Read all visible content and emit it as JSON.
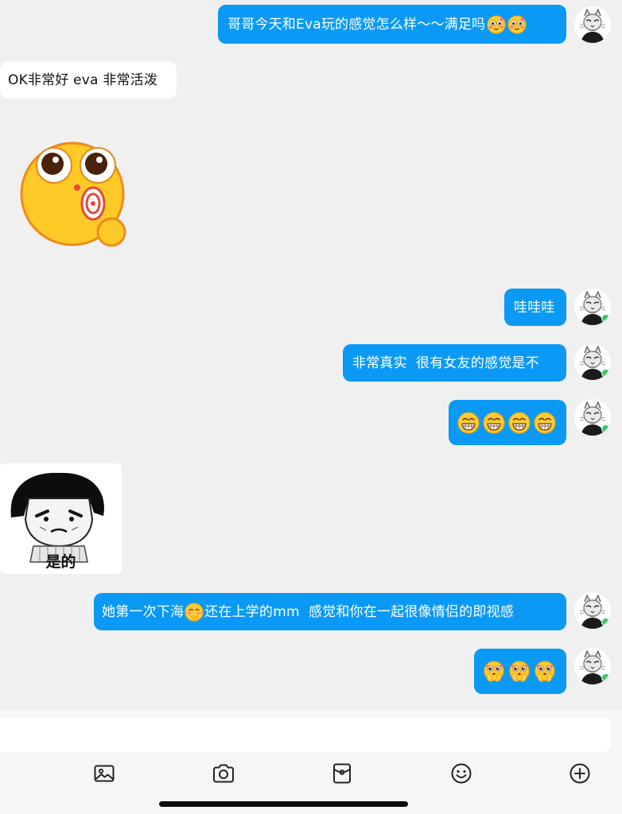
{
  "messages": [
    {
      "side": "me",
      "text": "哥哥今天和Eva玩的感觉怎么样～～满足吗",
      "trailing_emojis": [
        "flushed-face-emoji",
        "flushed-face-emoji"
      ]
    },
    {
      "side": "them",
      "text": "OK非常好 eva 非常活泼"
    },
    {
      "side": "them",
      "type": "sticker",
      "sticker": "lollipop-face-sticker"
    },
    {
      "side": "me",
      "text": "哇哇哇"
    },
    {
      "side": "me",
      "text": "非常真实  很有女友的感觉是不"
    },
    {
      "side": "me",
      "type": "emoji",
      "emojis": [
        "grinning-face-emoji",
        "grinning-face-emoji",
        "grinning-face-emoji",
        "grinning-face-emoji"
      ]
    },
    {
      "side": "them",
      "type": "sticker",
      "sticker": "meme-face-sticker",
      "caption": "是的"
    },
    {
      "side": "me",
      "text_before": "她第一次下海",
      "inline_emoji": "shy-face-emoji",
      "text_after": "还在上学的mm  感觉和你在一起很像情侣的即视感"
    },
    {
      "side": "me",
      "type": "emoji",
      "emojis": [
        "begging-face-emoji",
        "begging-face-emoji",
        "begging-face-emoji"
      ]
    }
  ],
  "input": {
    "placeholder": "",
    "value": ""
  },
  "toolbar": [
    {
      "icon": "image-icon"
    },
    {
      "icon": "camera-icon"
    },
    {
      "icon": "red-packet-icon"
    },
    {
      "icon": "emoji-icon"
    },
    {
      "icon": "plus-icon"
    }
  ],
  "colors": {
    "bubble_me": "#0a9af5",
    "background": "#f0f0f0",
    "bubble_them": "#ffffff"
  }
}
